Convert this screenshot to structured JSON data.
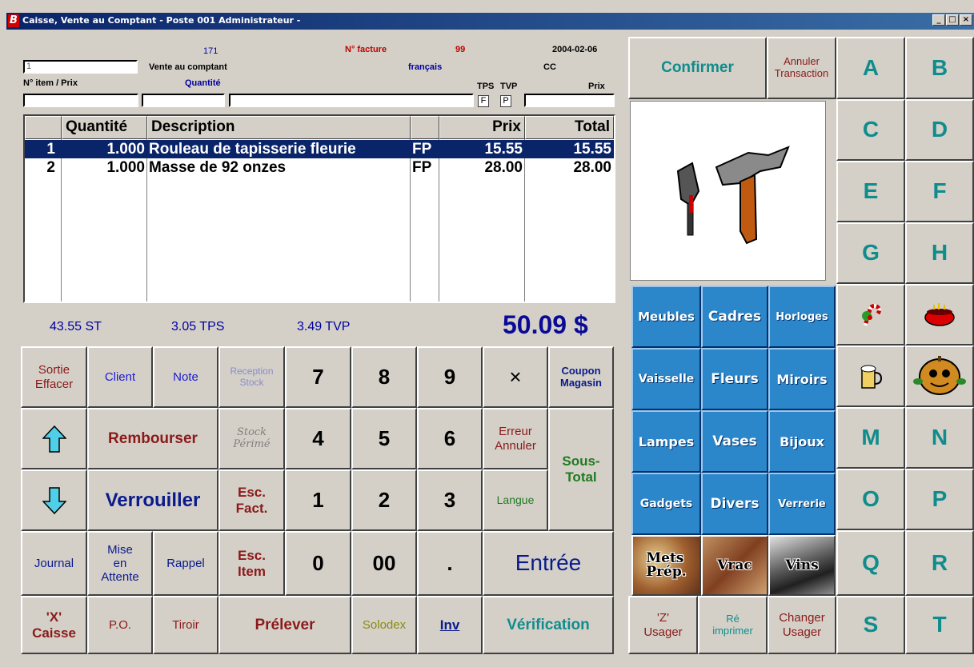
{
  "window": {
    "title": "Caisse, Vente au Comptant  - Poste 001 Administrateur -",
    "app_icon": "B",
    "controls": [
      "_",
      "□",
      "×"
    ]
  },
  "header": {
    "code": "171",
    "invoice_label": "N° facture",
    "invoice_number": "99",
    "date": "2004-02-06",
    "customer_field_value": "1",
    "sale_type": "Vente au comptant",
    "language": "français",
    "cc": "CC",
    "item_price_label": "N° item / Prix",
    "quantity_label": "Quantité",
    "tps_label": "TPS",
    "tvp_label": "TVP",
    "price_label": "Prix",
    "tps_flag": "F",
    "tvp_flag": "P"
  },
  "grid": {
    "columns": [
      "",
      "Quantité",
      "Description",
      "",
      "Prix",
      "Total"
    ],
    "rows": [
      {
        "num": "1",
        "qty": "1.000",
        "desc": "Rouleau de tapisserie fleurie",
        "tax": "FP",
        "price": "15.55",
        "total": "15.55",
        "selected": true
      },
      {
        "num": "2",
        "qty": "1.000",
        "desc": "Masse de 92 onzes",
        "tax": "FP",
        "price": "28.00",
        "total": "28.00",
        "selected": false
      }
    ]
  },
  "totals": {
    "subtotal": "43.55 ST",
    "tps": "3.05 TPS",
    "tvp": "3.49 TVP",
    "grand_total": "50.09 $"
  },
  "keypad": {
    "sortie": "Sortie\nEffacer",
    "client": "Client",
    "note": "Note",
    "reception": "Reception\nStock",
    "k7": "7",
    "k8": "8",
    "k9": "9",
    "times": "×",
    "coupon": "Coupon\nMagasin",
    "up_icon": "up-arrow-icon",
    "rembourser": "Rembourser",
    "stock_perime": "Stock\nPérimé",
    "k4": "4",
    "k5": "5",
    "k6": "6",
    "erreur": "Erreur\nAnnuler",
    "sous_total": "Sous-\nTotal",
    "down_icon": "down-arrow-icon",
    "verrouiller": "Verrouiller",
    "esc_fact": "Esc.\nFact.",
    "k1": "1",
    "k2": "2",
    "k3": "3",
    "langue": "Langue",
    "journal": "Journal",
    "mise_attente": "Mise\nen\nAttente",
    "rappel": "Rappel",
    "esc_item": "Esc.\nItem",
    "k0": "0",
    "k00": "00",
    "dot": ".",
    "entree": "Entrée",
    "caisse": "'X'\nCaisse",
    "po": "P.O.",
    "tiroir": "Tiroir",
    "prelever": "Prélever",
    "solodex": "Solodex",
    "inv": "Inv",
    "verification": "Vérification"
  },
  "right_panel": {
    "confirmer": "Confirmer",
    "annuler": "Annuler\nTransaction",
    "letters": [
      "A",
      "B",
      "C",
      "D",
      "E",
      "F",
      "G",
      "H",
      "M",
      "N",
      "O",
      "P",
      "Q",
      "R",
      "S",
      "T"
    ],
    "categories": [
      "Meubles",
      "Cadres",
      "Horloges",
      "Vaisselle",
      "Fleurs",
      "Miroirs",
      "Lampes",
      "Vases",
      "Bijoux",
      "Gadgets",
      "Divers",
      "Verrerie"
    ],
    "photo_buttons": [
      "Mets\nPrép.",
      "Vrac",
      "Vins"
    ],
    "z_usager": "'Z'\nUsager",
    "reimprimer": "Ré\nimprimer",
    "changer_usager": "Changer\nUsager",
    "icon_buttons": [
      "candy-cane-icon",
      "cauldron-icon",
      "beer-mug-icon",
      "pumpkin-mascot-icon"
    ],
    "preview_icon": "hammer-trowel-icon"
  },
  "colors": {
    "face": "#d4d0c8",
    "category_blue": "#2b87c9",
    "selection": "#0a246a",
    "teal_text": "#0f8c8c"
  }
}
